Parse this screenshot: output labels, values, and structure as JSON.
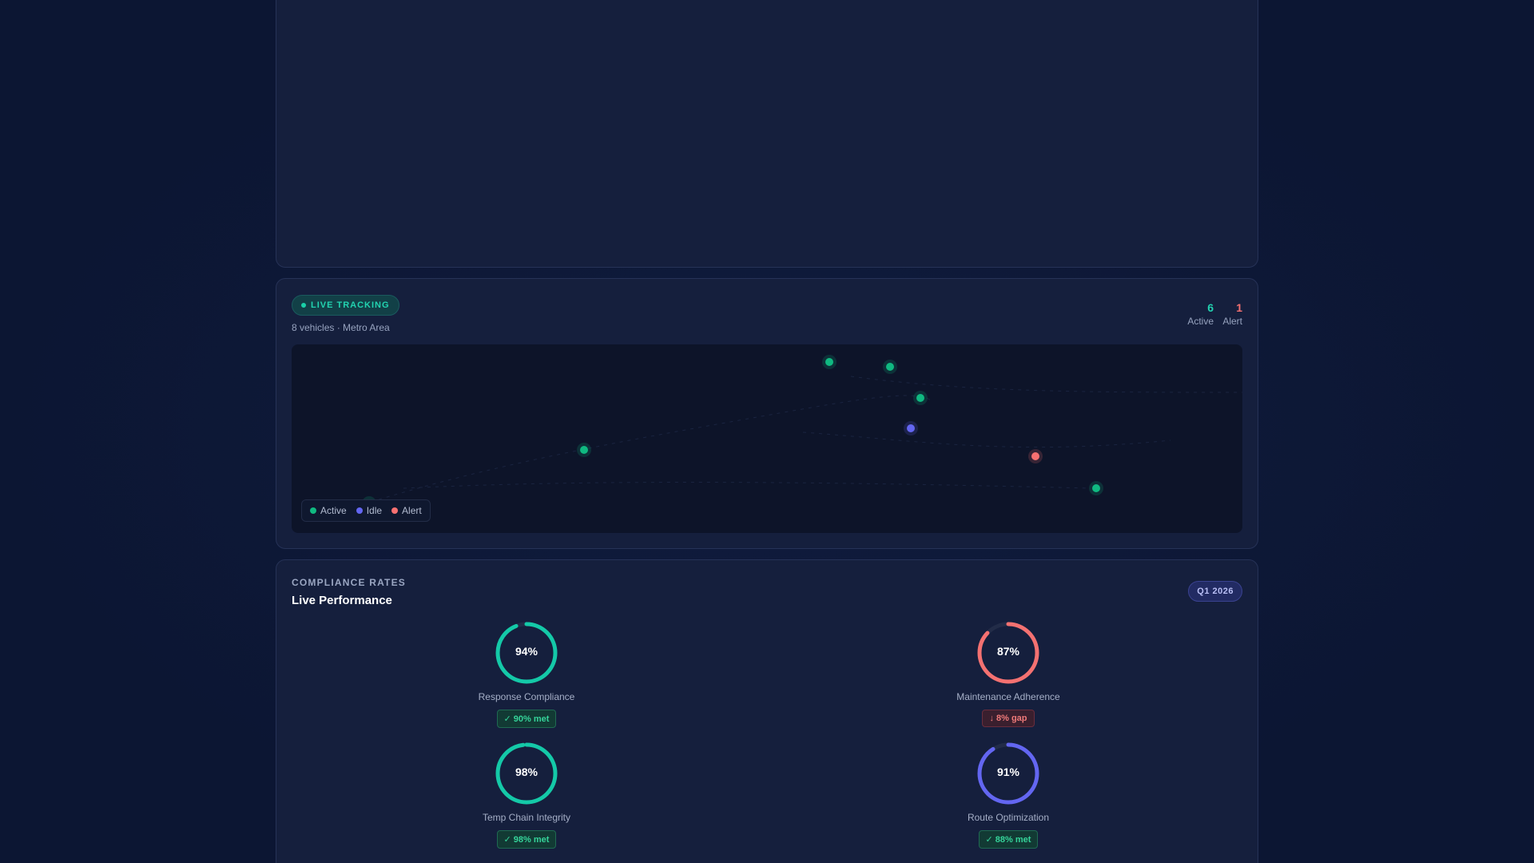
{
  "tracking": {
    "badge": "LIVE TRACKING",
    "subtitle": "8 vehicles · Metro Area",
    "stats": {
      "active_value": "6",
      "active_label": "Active",
      "alert_value": "1",
      "alert_label": "Alert"
    },
    "legend": [
      {
        "label": "Active",
        "color": "#10b981"
      },
      {
        "label": "Idle",
        "color": "#6366f1"
      },
      {
        "label": "Alert",
        "color": "#f87171"
      }
    ],
    "vehicles": [
      {
        "status": "active"
      },
      {
        "status": "active"
      },
      {
        "status": "active"
      },
      {
        "status": "idle"
      },
      {
        "status": "active"
      },
      {
        "status": "alert"
      },
      {
        "status": "active"
      },
      {
        "status": "active"
      }
    ]
  },
  "compliance": {
    "eyebrow": "COMPLIANCE RATES",
    "title": "Live Performance",
    "period": "Q1 2026",
    "gauges": [
      {
        "name": "Response Compliance",
        "value": 94,
        "value_label": "94%",
        "color": "#14c9a8",
        "badge": "✓ 90% met",
        "badge_type": "good"
      },
      {
        "name": "Maintenance Adherence",
        "value": 87,
        "value_label": "87%",
        "color": "#f47171",
        "badge": "↓ 8% gap",
        "badge_type": "bad"
      },
      {
        "name": "Temp Chain Integrity",
        "value": 98,
        "value_label": "98%",
        "color": "#14c9a8",
        "badge": "✓ 98% met",
        "badge_type": "good"
      },
      {
        "name": "Route Optimization",
        "value": 91,
        "value_label": "91%",
        "color": "#6366f1",
        "badge": "✓ 88% met",
        "badge_type": "good"
      }
    ]
  },
  "colors": {
    "active": "#10b981",
    "idle": "#6366f1",
    "alert": "#f87171"
  }
}
